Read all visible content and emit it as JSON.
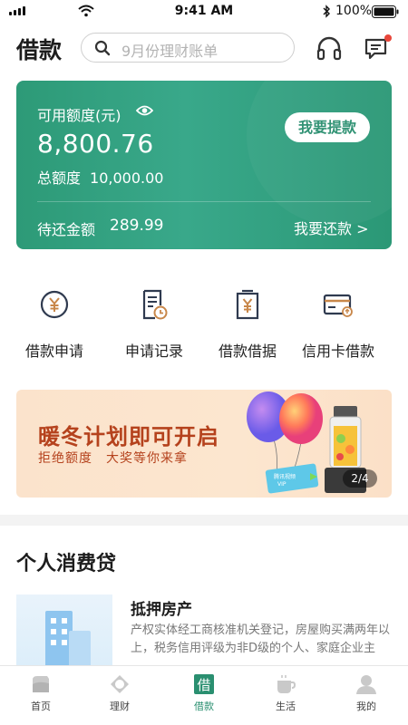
{
  "status_bar": {
    "time": "9:41 AM",
    "battery": "100%"
  },
  "header": {
    "title": "借款",
    "search_placeholder": "9月份理财账单"
  },
  "credit": {
    "available_label": "可用额度(元)",
    "available_amount": "8,800.76",
    "total_label": "总额度",
    "total_amount": "10,000.00",
    "withdraw_button": "我要提款",
    "repay_label": "待还金额",
    "repay_amount": "289.99",
    "repay_link": "我要还款 >"
  },
  "actions": [
    {
      "label": "借款申请",
      "icon": "yen-circle-icon"
    },
    {
      "label": "申请记录",
      "icon": "document-clock-icon"
    },
    {
      "label": "借款借据",
      "icon": "yen-receipt-icon"
    },
    {
      "label": "信用卡借款",
      "icon": "credit-card-icon"
    }
  ],
  "banner": {
    "title": "暖冬计划即可开启",
    "subtitle": "拒绝额度　大奖等你来拿",
    "pager": "2/4"
  },
  "section": {
    "title": "个人消费贷"
  },
  "product": {
    "name": "抵押房产",
    "description": "产权实体经工商核准机关登记，房屋购买满两年以上，税务信用评级为非D级的个人、家庭企业主"
  },
  "tabbar": {
    "items": [
      {
        "label": "首页",
        "icon": "home-icon"
      },
      {
        "label": "理财",
        "icon": "finance-icon"
      },
      {
        "label": "借款",
        "icon": "loan-icon",
        "active": true
      },
      {
        "label": "生活",
        "icon": "coffee-cup-icon"
      },
      {
        "label": "我的",
        "icon": "user-icon"
      }
    ]
  },
  "colors": {
    "accent": "#2d9a77",
    "banner_text": "#b5421d",
    "badge": "#e8463a"
  }
}
